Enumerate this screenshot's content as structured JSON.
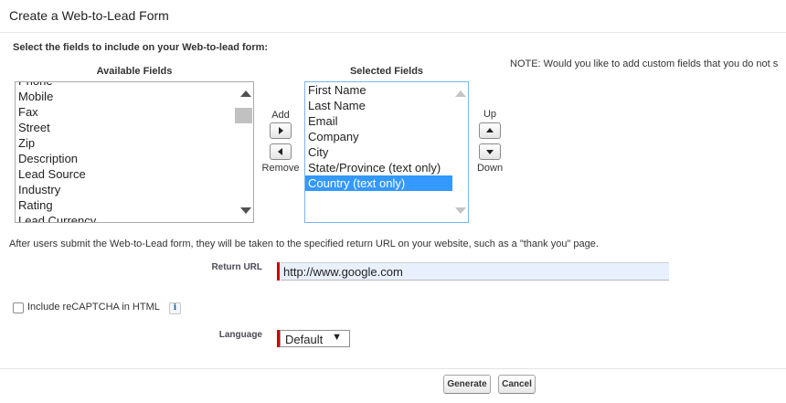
{
  "title": "Create a Web-to-Lead Form",
  "instruction": "Select the fields to include on your Web-to-lead form:",
  "note": "NOTE: Would you like to add custom fields that you do not s",
  "available": {
    "header": "Available Fields",
    "items": [
      "Phone",
      "Mobile",
      "Fax",
      "Street",
      "Zip",
      "Description",
      "Lead Source",
      "Industry",
      "Rating",
      "Lead Currency"
    ]
  },
  "selected": {
    "header": "Selected Fields",
    "items": [
      "First Name",
      "Last Name",
      "Email",
      "Company",
      "City",
      "State/Province (text only)",
      "Country (text only)"
    ],
    "selected_item": "Country (text only)"
  },
  "add_label": "Add",
  "remove_label": "Remove",
  "up_label": "Up",
  "down_label": "Down",
  "return_info": "After users submit the Web-to-Lead form, they will be taken to the specified return URL on your website, such as a \"thank you\" page.",
  "return_url": {
    "label": "Return URL",
    "value": "http://www.google.com"
  },
  "recaptcha": {
    "label": "Include reCAPTCHA in HTML",
    "checked": false,
    "info_icon_text": "i"
  },
  "language": {
    "label": "Language",
    "value": "Default",
    "caret": "▼"
  },
  "buttons": {
    "generate": "Generate",
    "cancel": "Cancel"
  },
  "colors": {
    "selection": "#3399ff",
    "required": "#cc0000",
    "input_bg": "#e8f0fe"
  },
  "icons": {
    "add": "right-triangle-icon",
    "remove": "left-triangle-icon",
    "up": "up-triangle-icon",
    "down": "down-triangle-icon",
    "info": "info-icon",
    "scroll_up": "scroll-up-arrow-icon",
    "scroll_down": "scroll-down-arrow-icon"
  }
}
